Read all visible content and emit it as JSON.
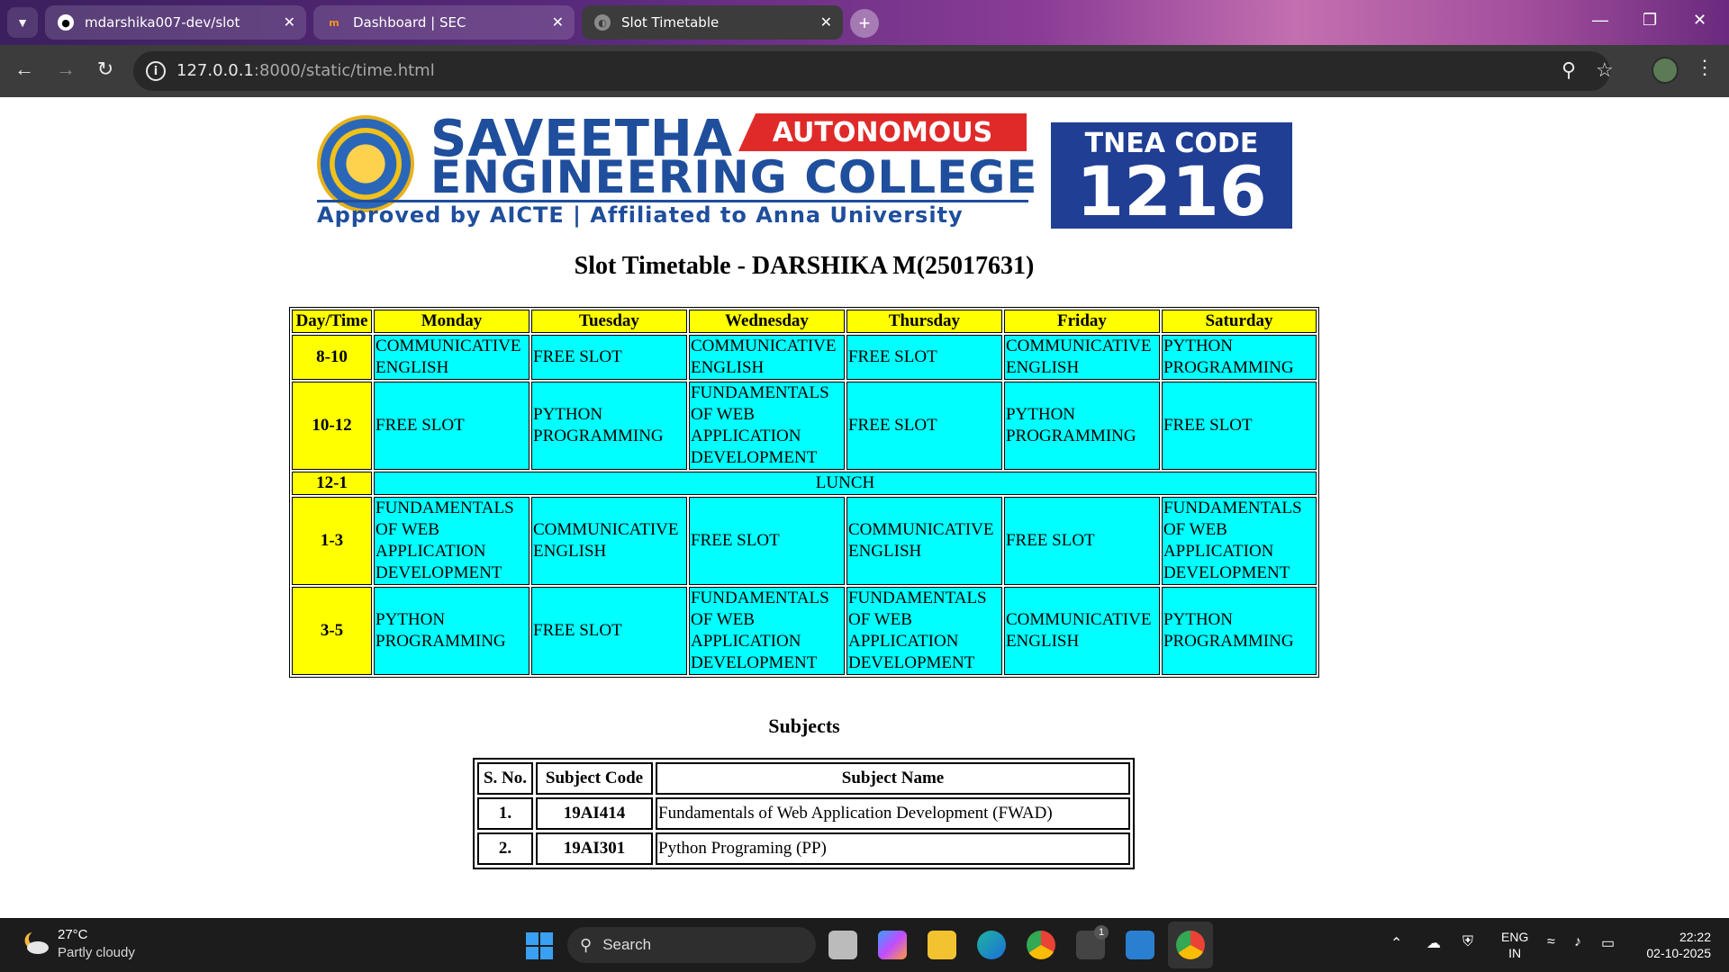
{
  "browser": {
    "tabs": [
      {
        "title": "mdarshika007-dev/slot",
        "favicon": "github-icon"
      },
      {
        "title": "Dashboard | SEC",
        "favicon": "moodle-icon"
      },
      {
        "title": "Slot Timetable",
        "favicon": "globe-icon"
      }
    ],
    "active_tab": 2,
    "url_host": "127.0.0.1",
    "url_path": ":8000/static/time.html"
  },
  "header": {
    "college_line1": "SAVEETHA",
    "college_line2": "ENGINEERING COLLEGE",
    "autonomous": "AUTONOMOUS",
    "approved": "Approved by AICTE  |  Affiliated to Anna University",
    "tnea_label": "TNEA CODE",
    "tnea_code": "1216"
  },
  "page": {
    "title": "Slot Timetable - DARSHIKA M(25017631)",
    "subjects_heading": "Subjects"
  },
  "timetable": {
    "headers": [
      "Day/Time",
      "Monday",
      "Tuesday",
      "Wednesday",
      "Thursday",
      "Friday",
      "Saturday"
    ],
    "rows": [
      {
        "time": "8-10",
        "cells": [
          "COMMUNICATIVE ENGLISH",
          "FREE SLOT",
          "COMMUNICATIVE ENGLISH",
          "FREE SLOT",
          "COMMUNICATIVE ENGLISH",
          "PYTHON PROGRAMMING"
        ]
      },
      {
        "time": "10-12",
        "cells": [
          "FREE SLOT",
          "PYTHON PROGRAMMING",
          "FUNDAMENTALS OF WEB APPLICATION DEVELOPMENT",
          "FREE SLOT",
          "PYTHON PROGRAMMING",
          "FREE SLOT"
        ]
      },
      {
        "time": "12-1",
        "lunch": "LUNCH"
      },
      {
        "time": "1-3",
        "cells": [
          "FUNDAMENTALS OF WEB APPLICATION DEVELOPMENT",
          "COMMUNICATIVE ENGLISH",
          "FREE SLOT",
          "COMMUNICATIVE ENGLISH",
          "FREE SLOT",
          "FUNDAMENTALS OF WEB APPLICATION DEVELOPMENT"
        ]
      },
      {
        "time": "3-5",
        "cells": [
          "PYTHON PROGRAMMING",
          "FREE SLOT",
          "FUNDAMENTALS OF WEB APPLICATION DEVELOPMENT",
          "FUNDAMENTALS OF WEB APPLICATION DEVELOPMENT",
          "COMMUNICATIVE ENGLISH",
          "PYTHON PROGRAMMING"
        ]
      }
    ]
  },
  "subjects": {
    "headers": [
      "S. No.",
      "Subject Code",
      "Subject Name"
    ],
    "rows": [
      {
        "sno": "1.",
        "code": "19AI414",
        "name": "Fundamentals of Web Application Development (FWAD)"
      },
      {
        "sno": "2.",
        "code": "19AI301",
        "name": "Python Programing (PP)"
      }
    ]
  },
  "taskbar": {
    "weather_temp": "27°C",
    "weather_desc": "Partly cloudy",
    "search_label": "Search",
    "lang_line1": "ENG",
    "lang_line2": "IN",
    "time": "22:22",
    "date": "02-10-2025",
    "store_badge": "1"
  },
  "colors": {
    "header_fill": "#ffff00",
    "cell_fill": "#00ffff",
    "brand_blue": "#1f4e9c",
    "brand_red": "#e02a2a"
  }
}
